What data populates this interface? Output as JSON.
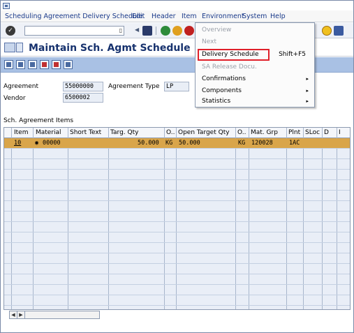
{
  "menu": {
    "items": [
      "Scheduling Agreement Delivery Schedule",
      "Edit",
      "Header",
      "Item",
      "Environment",
      "System",
      "Help"
    ]
  },
  "toolbar": {
    "okcode_value": "",
    "history_symbol": "▯"
  },
  "title": "Maintain Sch. Agmt Schedule : Ite",
  "header": {
    "agreement_label": "Agreement",
    "agreement_value": "55000000",
    "agreement_type_label": "Agreement Type",
    "agreement_type_value": "LP",
    "vendor_label": "Vendor",
    "vendor_value": "6500002"
  },
  "section_title": "Sch. Agreement Items",
  "table": {
    "headers": [
      "Item",
      "Material",
      "Short Text",
      "Targ. Qty",
      "O..",
      "Open Target Qty",
      "O..",
      "Mat. Grp",
      "Plnt",
      "SLoc",
      "D",
      "I"
    ],
    "rows": [
      {
        "item": "10",
        "material": "00000",
        "short_text": "",
        "targ_qty": "50.000",
        "unit1": "KG",
        "open_target_qty": "50.000",
        "unit2": "KG",
        "mat_grp": "120028",
        "plnt": "1AC",
        "sloc": "",
        "d": "",
        "i": ""
      }
    ]
  },
  "dropdown": {
    "items": [
      {
        "label": "Overview",
        "enabled": false,
        "accel": "",
        "submenu": false
      },
      {
        "label": "Next",
        "enabled": false,
        "accel": "",
        "submenu": false
      },
      {
        "label": "Delivery Schedule",
        "enabled": true,
        "accel": "Shift+F5",
        "submenu": false,
        "highlighted": true
      },
      {
        "label": "SA Release Docu.",
        "enabled": false,
        "accel": "",
        "submenu": false
      },
      {
        "label": "Confirmations",
        "enabled": true,
        "accel": "",
        "submenu": true
      },
      {
        "label": "Components",
        "enabled": true,
        "accel": "",
        "submenu": true
      },
      {
        "label": "Statistics",
        "enabled": true,
        "accel": "",
        "submenu": true
      }
    ]
  },
  "colors": {
    "selected_row": "#d9a54a",
    "highlight_box": "#e0202a",
    "title_text": "#17326e",
    "app_toolbar": "#a9c1e4"
  }
}
